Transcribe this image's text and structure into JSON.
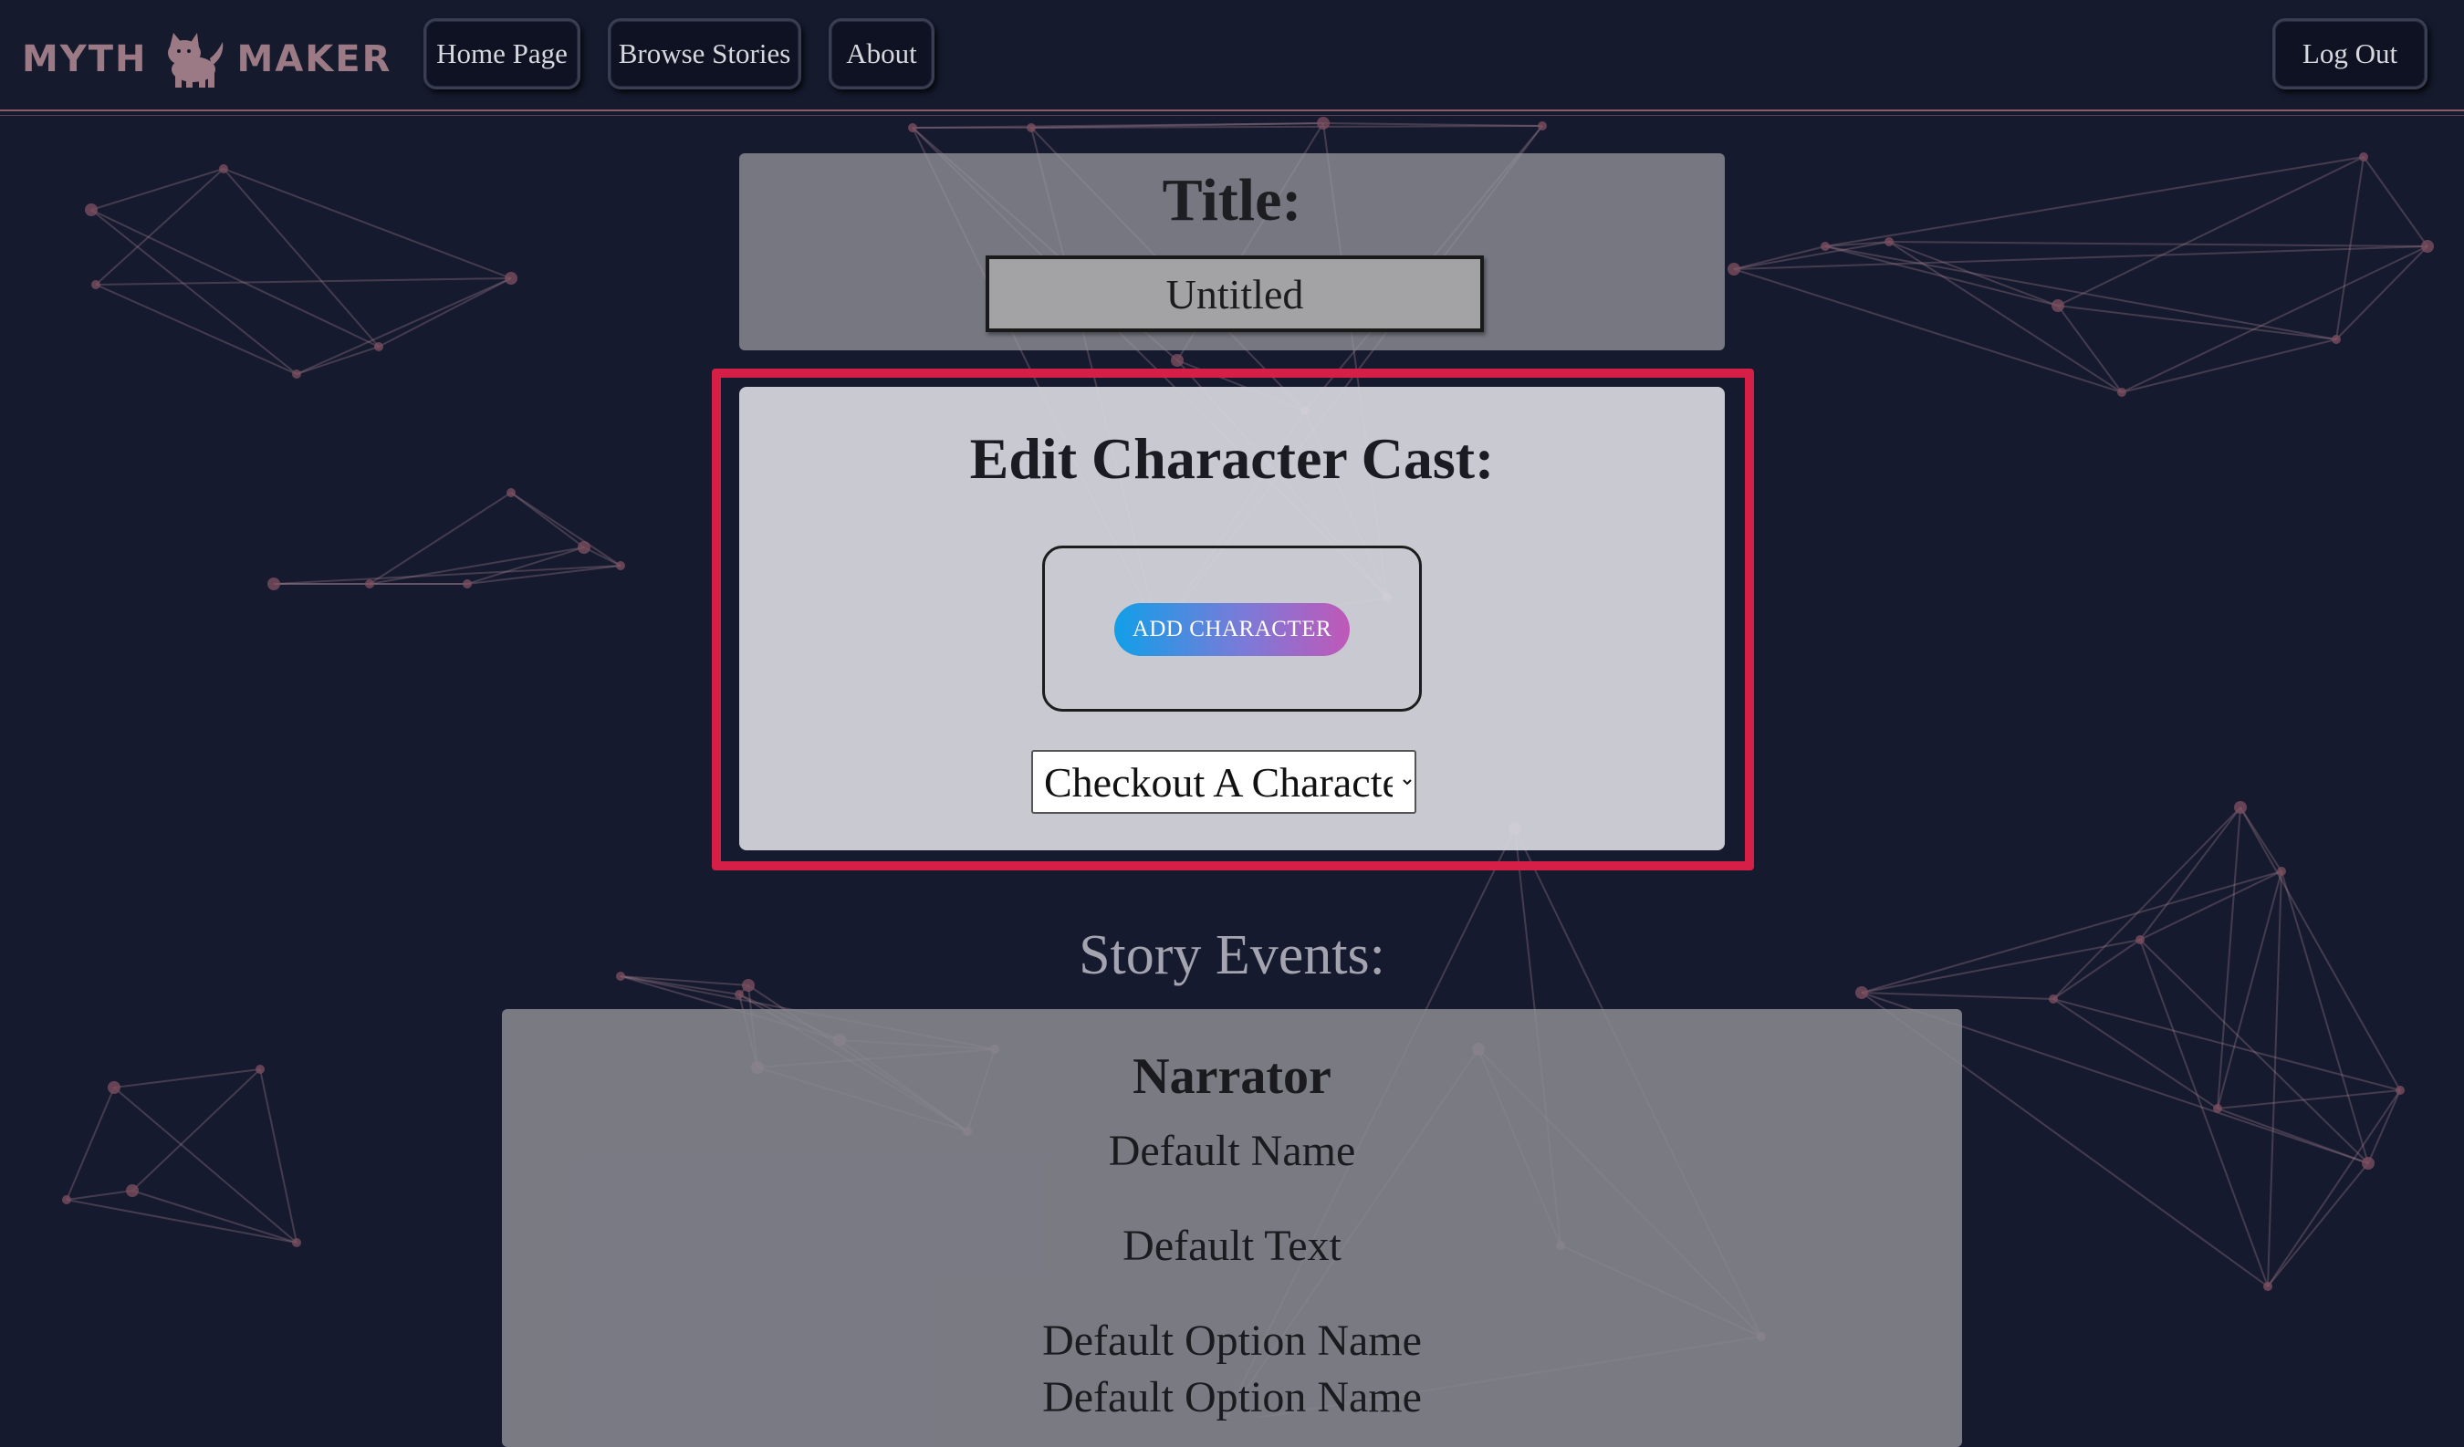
{
  "header": {
    "logo_left": "MYTH",
    "logo_right": "MAKER",
    "nav": [
      "Home Page",
      "Browse Stories",
      "About"
    ],
    "logout_label": "Log Out"
  },
  "title_panel": {
    "heading": "Title:",
    "value": "Untitled"
  },
  "cast_panel": {
    "heading": "Edit Character Cast:",
    "add_button": "ADD CHARACTER",
    "select_value": "Checkout A Character"
  },
  "events": {
    "heading": "Story Events:",
    "card": {
      "speaker": "Narrator",
      "name": "Default Name",
      "text": "Default Text",
      "options": [
        "Default Option Name",
        "Default Option Name"
      ]
    }
  },
  "colors": {
    "background": "#161a2e",
    "highlight": "#d61f47",
    "accent_gradient_start": "#119fe8",
    "accent_gradient_end": "#c058b8",
    "logo": "#9c7a85"
  }
}
